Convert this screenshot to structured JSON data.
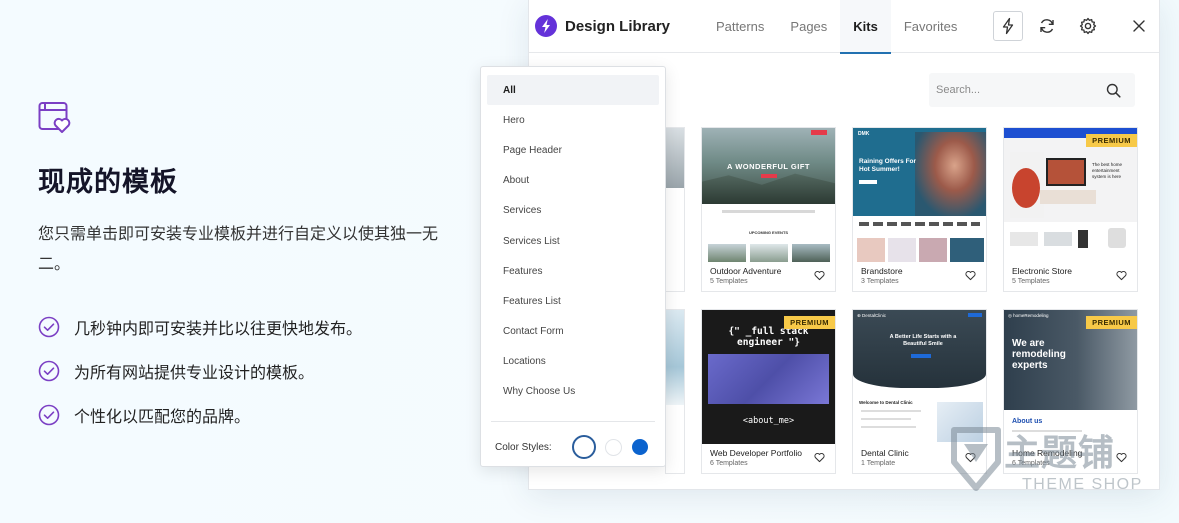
{
  "feature": {
    "icon": "template-heart-icon",
    "title": "现成的模板",
    "description": "您只需单击即可安装专业模板并进行自定义以使其独一无二。",
    "bullets": [
      "几秒钟内即可安装并比以往更快地发布。",
      "为所有网站提供专业设计的模板。",
      "个性化以匹配您的品牌。"
    ],
    "accent_color": "#7b3fc4"
  },
  "library": {
    "title": "Design Library",
    "logo_icon": "lightning-bolt-logo-icon",
    "tabs": [
      {
        "label": "Patterns",
        "active": false
      },
      {
        "label": "Pages",
        "active": false
      },
      {
        "label": "Kits",
        "active": true
      },
      {
        "label": "Favorites",
        "active": false
      }
    ],
    "header_icons": [
      "lightning-icon",
      "refresh-icon",
      "gear-icon",
      "close-icon"
    ],
    "search_placeholder": "Search...",
    "premium_label": "PREMIUM",
    "kits": [
      {
        "name": "Outdoor Adventure",
        "count": "5 Templates",
        "premium": false,
        "hero_text": "A WONDERFUL GIFT",
        "sub_text": "UPCOMING EVENTS"
      },
      {
        "name": "Brandstore",
        "count": "3 Templates",
        "premium": false,
        "hero_text": "Raining Offers For Hot Summer!"
      },
      {
        "name": "Electronic Store",
        "count": "5 Templates",
        "premium": true,
        "hero_text": "The best home entertainment system is here"
      },
      {
        "name": "Web Developer Portfolio",
        "count": "6 Templates",
        "premium": true,
        "hero_text": "{\" _full stack engineer \"}",
        "sub_text": "<about_me>"
      },
      {
        "name": "Dental Clinic",
        "count": "1 Template",
        "premium": false,
        "hero_text": "A Better Life Starts with a Beautiful Smile",
        "sub_text": "Welcome to Dental Clinic"
      },
      {
        "name": "Home Remodeling",
        "count": "6 Templates",
        "premium": true,
        "hero_text": "We are remodeling experts",
        "sub_text": "About us"
      }
    ]
  },
  "dropdown": {
    "items": [
      {
        "label": "All",
        "active": true
      },
      {
        "label": "Hero",
        "active": false
      },
      {
        "label": "Page Header",
        "active": false
      },
      {
        "label": "About",
        "active": false
      },
      {
        "label": "Services",
        "active": false
      },
      {
        "label": "Services List",
        "active": false
      },
      {
        "label": "Features",
        "active": false
      },
      {
        "label": "Features List",
        "active": false
      },
      {
        "label": "Contact Form",
        "active": false
      },
      {
        "label": "Locations",
        "active": false
      },
      {
        "label": "Why Choose Us",
        "active": false
      }
    ],
    "color_styles_label": "Color Styles:",
    "color_swatches": [
      "#ffffff",
      "#ffffff",
      "#0b63ce"
    ]
  },
  "watermark": {
    "cn": "主题铺",
    "en": "THEME SHOP"
  }
}
